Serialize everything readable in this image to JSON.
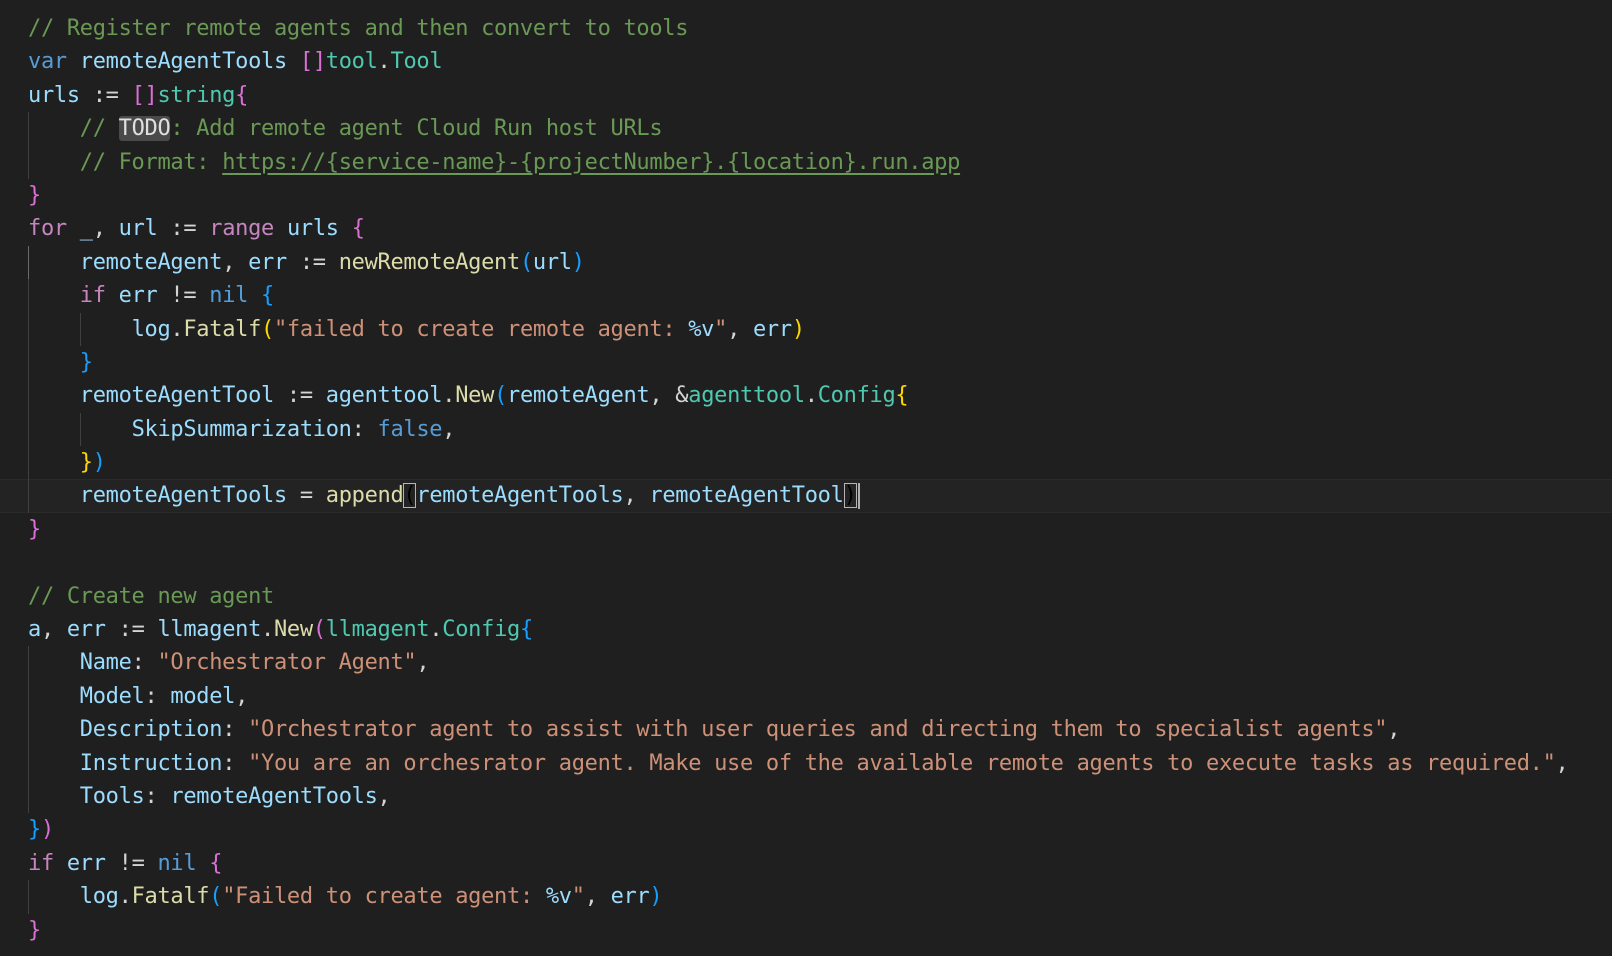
{
  "editor": {
    "lines": [
      {
        "guides": [],
        "tokens": [
          {
            "t": "// Register remote agents and then convert to tools",
            "c": "comment"
          }
        ]
      },
      {
        "guides": [],
        "tokens": [
          {
            "t": "var",
            "c": "keyword"
          },
          {
            "t": " ",
            "c": "plain"
          },
          {
            "t": "remoteAgentTools",
            "c": "var"
          },
          {
            "t": " ",
            "c": "plain"
          },
          {
            "t": "[]",
            "c": "br1"
          },
          {
            "t": "tool",
            "c": "type"
          },
          {
            "t": ".",
            "c": "plain"
          },
          {
            "t": "Tool",
            "c": "type"
          }
        ]
      },
      {
        "guides": [],
        "tokens": [
          {
            "t": "urls",
            "c": "var"
          },
          {
            "t": " := ",
            "c": "plain"
          },
          {
            "t": "[]",
            "c": "br1"
          },
          {
            "t": "string",
            "c": "type"
          },
          {
            "t": "{",
            "c": "br1"
          }
        ]
      },
      {
        "guides": [
          1
        ],
        "tokens": [
          {
            "t": "    // ",
            "c": "comment"
          },
          {
            "t": "TODO",
            "c": "todo"
          },
          {
            "t": ": Add remote agent Cloud Run host URLs",
            "c": "comment"
          }
        ]
      },
      {
        "guides": [
          1
        ],
        "tokens": [
          {
            "t": "    // Format: ",
            "c": "comment"
          },
          {
            "t": "https://{service-name}-{projectNumber}.{location}.run.app",
            "c": "link"
          }
        ]
      },
      {
        "guides": [],
        "tokens": [
          {
            "t": "}",
            "c": "br1"
          }
        ]
      },
      {
        "guides": [],
        "tokens": [
          {
            "t": "for",
            "c": "control"
          },
          {
            "t": " ",
            "c": "plain"
          },
          {
            "t": "_",
            "c": "var"
          },
          {
            "t": ", ",
            "c": "plain"
          },
          {
            "t": "url",
            "c": "var"
          },
          {
            "t": " := ",
            "c": "plain"
          },
          {
            "t": "range",
            "c": "control"
          },
          {
            "t": " ",
            "c": "plain"
          },
          {
            "t": "urls",
            "c": "var"
          },
          {
            "t": " ",
            "c": "plain"
          },
          {
            "t": "{",
            "c": "br1"
          }
        ]
      },
      {
        "guides": [
          1
        ],
        "active": true,
        "tokens": [
          {
            "t": "    ",
            "c": "plain"
          },
          {
            "t": "remoteAgent",
            "c": "var"
          },
          {
            "t": ", ",
            "c": "plain"
          },
          {
            "t": "err",
            "c": "var"
          },
          {
            "t": " := ",
            "c": "plain"
          },
          {
            "t": "newRemoteAgent",
            "c": "func"
          },
          {
            "t": "(",
            "c": "br2"
          },
          {
            "t": "url",
            "c": "var"
          },
          {
            "t": ")",
            "c": "br2"
          }
        ]
      },
      {
        "guides": [
          1
        ],
        "tokens": [
          {
            "t": "    ",
            "c": "plain"
          },
          {
            "t": "if",
            "c": "control"
          },
          {
            "t": " ",
            "c": "plain"
          },
          {
            "t": "err",
            "c": "var"
          },
          {
            "t": " != ",
            "c": "plain"
          },
          {
            "t": "nil",
            "c": "keyword"
          },
          {
            "t": " ",
            "c": "plain"
          },
          {
            "t": "{",
            "c": "br2"
          }
        ]
      },
      {
        "guides": [
          1,
          2
        ],
        "tokens": [
          {
            "t": "        ",
            "c": "plain"
          },
          {
            "t": "log",
            "c": "var"
          },
          {
            "t": ".",
            "c": "plain"
          },
          {
            "t": "Fatalf",
            "c": "func"
          },
          {
            "t": "(",
            "c": "br3"
          },
          {
            "t": "\"failed to create remote agent: ",
            "c": "string"
          },
          {
            "t": "%v",
            "c": "fmt"
          },
          {
            "t": "\"",
            "c": "string"
          },
          {
            "t": ", ",
            "c": "plain"
          },
          {
            "t": "err",
            "c": "var"
          },
          {
            "t": ")",
            "c": "br3"
          }
        ]
      },
      {
        "guides": [
          1
        ],
        "tokens": [
          {
            "t": "    ",
            "c": "plain"
          },
          {
            "t": "}",
            "c": "br2"
          }
        ]
      },
      {
        "guides": [
          1
        ],
        "tokens": [
          {
            "t": "    ",
            "c": "plain"
          },
          {
            "t": "remoteAgentTool",
            "c": "var"
          },
          {
            "t": " := ",
            "c": "plain"
          },
          {
            "t": "agenttool",
            "c": "var"
          },
          {
            "t": ".",
            "c": "plain"
          },
          {
            "t": "New",
            "c": "func"
          },
          {
            "t": "(",
            "c": "br2"
          },
          {
            "t": "remoteAgent",
            "c": "var"
          },
          {
            "t": ", &",
            "c": "plain"
          },
          {
            "t": "agenttool",
            "c": "type"
          },
          {
            "t": ".",
            "c": "plain"
          },
          {
            "t": "Config",
            "c": "type"
          },
          {
            "t": "{",
            "c": "br3"
          }
        ]
      },
      {
        "guides": [
          1,
          2
        ],
        "tokens": [
          {
            "t": "        ",
            "c": "plain"
          },
          {
            "t": "SkipSummarization",
            "c": "var"
          },
          {
            "t": ": ",
            "c": "plain"
          },
          {
            "t": "false",
            "c": "keyword"
          },
          {
            "t": ",",
            "c": "plain"
          }
        ]
      },
      {
        "guides": [
          1
        ],
        "tokens": [
          {
            "t": "    ",
            "c": "plain"
          },
          {
            "t": "}",
            "c": "br3"
          },
          {
            "t": ")",
            "c": "br2"
          }
        ]
      },
      {
        "guides": [
          1
        ],
        "current": true,
        "tokens": [
          {
            "t": "    ",
            "c": "plain"
          },
          {
            "t": "remoteAgentTools",
            "c": "var"
          },
          {
            "t": " = ",
            "c": "plain"
          },
          {
            "t": "append",
            "c": "func"
          },
          {
            "t": "(",
            "c": "match"
          },
          {
            "t": "remoteAgentTools",
            "c": "var"
          },
          {
            "t": ", ",
            "c": "plain"
          },
          {
            "t": "remoteAgentTool",
            "c": "var"
          },
          {
            "t": ")",
            "c": "match"
          },
          {
            "t": "",
            "c": "cursor"
          }
        ]
      },
      {
        "guides": [],
        "tokens": [
          {
            "t": "}",
            "c": "br1"
          }
        ]
      },
      {
        "guides": [],
        "tokens": []
      },
      {
        "guides": [],
        "tokens": [
          {
            "t": "// Create new agent",
            "c": "comment"
          }
        ]
      },
      {
        "guides": [],
        "tokens": [
          {
            "t": "a",
            "c": "var"
          },
          {
            "t": ", ",
            "c": "plain"
          },
          {
            "t": "err",
            "c": "var"
          },
          {
            "t": " := ",
            "c": "plain"
          },
          {
            "t": "llmagent",
            "c": "var"
          },
          {
            "t": ".",
            "c": "plain"
          },
          {
            "t": "New",
            "c": "func"
          },
          {
            "t": "(",
            "c": "br1"
          },
          {
            "t": "llmagent",
            "c": "type"
          },
          {
            "t": ".",
            "c": "plain"
          },
          {
            "t": "Config",
            "c": "type"
          },
          {
            "t": "{",
            "c": "br2"
          }
        ]
      },
      {
        "guides": [
          1
        ],
        "tokens": [
          {
            "t": "    ",
            "c": "plain"
          },
          {
            "t": "Name",
            "c": "var"
          },
          {
            "t": ": ",
            "c": "plain"
          },
          {
            "t": "\"Orchestrator Agent\"",
            "c": "string"
          },
          {
            "t": ",",
            "c": "plain"
          }
        ]
      },
      {
        "guides": [
          1
        ],
        "tokens": [
          {
            "t": "    ",
            "c": "plain"
          },
          {
            "t": "Model",
            "c": "var"
          },
          {
            "t": ": ",
            "c": "plain"
          },
          {
            "t": "model",
            "c": "var"
          },
          {
            "t": ",",
            "c": "plain"
          }
        ]
      },
      {
        "guides": [
          1
        ],
        "tokens": [
          {
            "t": "    ",
            "c": "plain"
          },
          {
            "t": "Description",
            "c": "var"
          },
          {
            "t": ": ",
            "c": "plain"
          },
          {
            "t": "\"Orchestrator agent to assist with user queries and directing them to specialist agents\"",
            "c": "string"
          },
          {
            "t": ",",
            "c": "plain"
          }
        ]
      },
      {
        "guides": [
          1
        ],
        "tokens": [
          {
            "t": "    ",
            "c": "plain"
          },
          {
            "t": "Instruction",
            "c": "var"
          },
          {
            "t": ": ",
            "c": "plain"
          },
          {
            "t": "\"You are an orchesrator agent. Make use of the available remote agents to execute tasks as required.\"",
            "c": "string"
          },
          {
            "t": ",",
            "c": "plain"
          }
        ]
      },
      {
        "guides": [
          1
        ],
        "tokens": [
          {
            "t": "    ",
            "c": "plain"
          },
          {
            "t": "Tools",
            "c": "var"
          },
          {
            "t": ": ",
            "c": "plain"
          },
          {
            "t": "remoteAgentTools",
            "c": "var"
          },
          {
            "t": ",",
            "c": "plain"
          }
        ]
      },
      {
        "guides": [],
        "tokens": [
          {
            "t": "}",
            "c": "br2"
          },
          {
            "t": ")",
            "c": "br1"
          }
        ]
      },
      {
        "guides": [],
        "tokens": [
          {
            "t": "if",
            "c": "control"
          },
          {
            "t": " ",
            "c": "plain"
          },
          {
            "t": "err",
            "c": "var"
          },
          {
            "t": " != ",
            "c": "plain"
          },
          {
            "t": "nil",
            "c": "keyword"
          },
          {
            "t": " ",
            "c": "plain"
          },
          {
            "t": "{",
            "c": "br1"
          }
        ]
      },
      {
        "guides": [
          1
        ],
        "tokens": [
          {
            "t": "    ",
            "c": "plain"
          },
          {
            "t": "log",
            "c": "var"
          },
          {
            "t": ".",
            "c": "plain"
          },
          {
            "t": "Fatalf",
            "c": "func"
          },
          {
            "t": "(",
            "c": "br2"
          },
          {
            "t": "\"Failed to create agent: ",
            "c": "string"
          },
          {
            "t": "%v",
            "c": "fmt"
          },
          {
            "t": "\"",
            "c": "string"
          },
          {
            "t": ", ",
            "c": "plain"
          },
          {
            "t": "err",
            "c": "var"
          },
          {
            "t": ")",
            "c": "br2"
          }
        ]
      },
      {
        "guides": [],
        "tokens": [
          {
            "t": "}",
            "c": "br1"
          }
        ]
      }
    ]
  }
}
